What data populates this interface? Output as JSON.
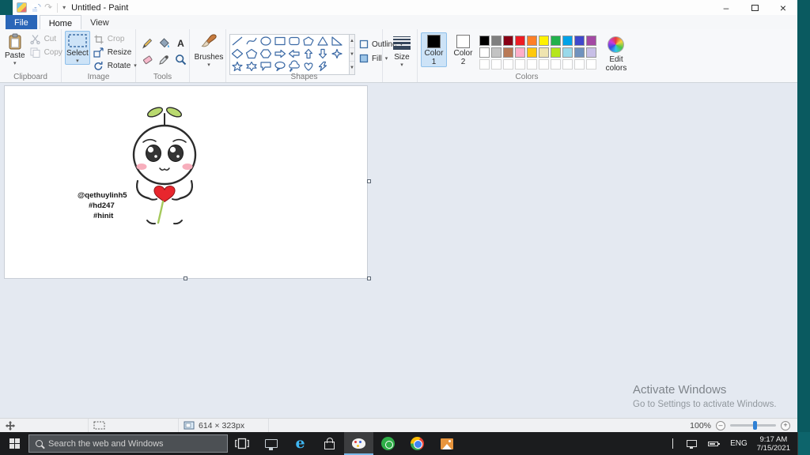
{
  "titlebar": {
    "title": "Untitled - Paint"
  },
  "tabs": {
    "file": "File",
    "home": "Home",
    "view": "View"
  },
  "ribbon": {
    "clipboard": {
      "label": "Clipboard",
      "paste": "Paste",
      "cut": "Cut",
      "copy": "Copy"
    },
    "image": {
      "label": "Image",
      "select": "Select",
      "crop": "Crop",
      "resize": "Resize",
      "rotate": "Rotate"
    },
    "tools": {
      "label": "Tools"
    },
    "brushes": {
      "label": "Brushes"
    },
    "shapes": {
      "label": "Shapes",
      "outline": "Outline",
      "fill": "Fill"
    },
    "size": {
      "label": "Size"
    },
    "colors": {
      "label": "Colors",
      "color1_label": "Color 1",
      "color2_label": "Color 2",
      "edit_label": "Edit colors",
      "color1_value": "#000000",
      "color2_value": "#ffffff",
      "row1": [
        "#000000",
        "#7f7f7f",
        "#880015",
        "#ed1c24",
        "#ff7f27",
        "#fff200",
        "#22b14c",
        "#00a2e8",
        "#3f48cc",
        "#a349a4"
      ],
      "row2": [
        "#ffffff",
        "#c3c3c3",
        "#b97a57",
        "#ffaec9",
        "#ffc90e",
        "#efe4b0",
        "#b5e61d",
        "#99d9ea",
        "#7092be",
        "#c8bfe7"
      ],
      "row3": [
        "",
        "",
        "",
        "",
        "",
        "",
        "",
        "",
        "",
        ""
      ]
    }
  },
  "canvas": {
    "watermark": [
      "@qethuylinh5",
      "#hd247",
      "#hinit"
    ]
  },
  "statusbar": {
    "dimensions": "614 × 323px",
    "zoom": "100%"
  },
  "activate": {
    "line1": "Activate Windows",
    "line2": "Go to Settings to activate Windows."
  },
  "taskbar": {
    "search_placeholder": "Search the web and Windows",
    "apps": [
      {
        "icon": "monitor"
      },
      {
        "icon": "edge"
      },
      {
        "icon": "store"
      },
      {
        "icon": "paint",
        "active": true
      },
      {
        "icon": "green"
      },
      {
        "icon": "chrome"
      },
      {
        "icon": "photos"
      }
    ],
    "tray": {
      "lang": "ENG",
      "time": "9:17 AM",
      "date": "7/15/2021"
    }
  }
}
